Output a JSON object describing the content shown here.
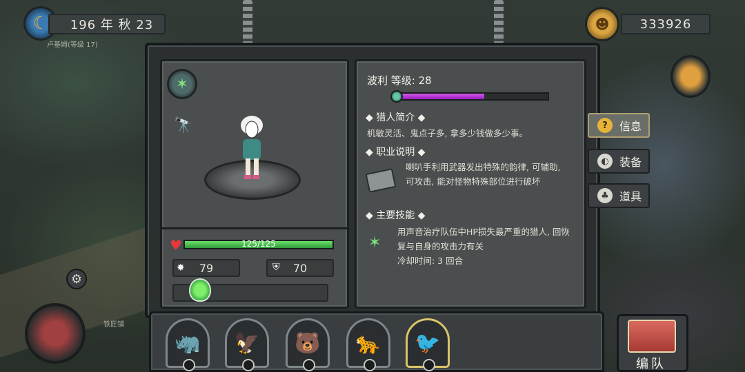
{
  "hud": {
    "date": "196 年 秋 23",
    "coins": "333926"
  },
  "map_labels": {
    "top_left": "卢基姆(等级 17)",
    "bottom_left": "铁匠铺"
  },
  "hero": {
    "name_level": "波利  等级: 28",
    "level_progress": 0.57,
    "hp": "125/125",
    "hp_fraction": 1.0,
    "attack": "79",
    "defense": "70"
  },
  "sections": {
    "intro_title": "◆  猎人简介  ◆",
    "intro_text": "机敏灵活、鬼点子多, 拿多少钱做多少事。",
    "job_title": "◆  职业说明  ◆",
    "job_text": "喇叭手利用武器发出特殊的韵律, 可辅助, 可攻击, 能对怪物特殊部位进行破坏",
    "skill_title": "◆  主要技能  ◆",
    "skill_text": "用声音治疗队伍中HP损失最严重的猎人, 回恢复与自身的攻击力有关",
    "cooldown": "冷却时间: 3 回合"
  },
  "tabs": {
    "info": "信息",
    "equip": "装备",
    "items": "道具"
  },
  "team": {
    "label": "编队"
  },
  "colors": {
    "hp_green": "#3fb24a",
    "level_purple": "#b43adf",
    "active_tab": "#e6b43a"
  }
}
